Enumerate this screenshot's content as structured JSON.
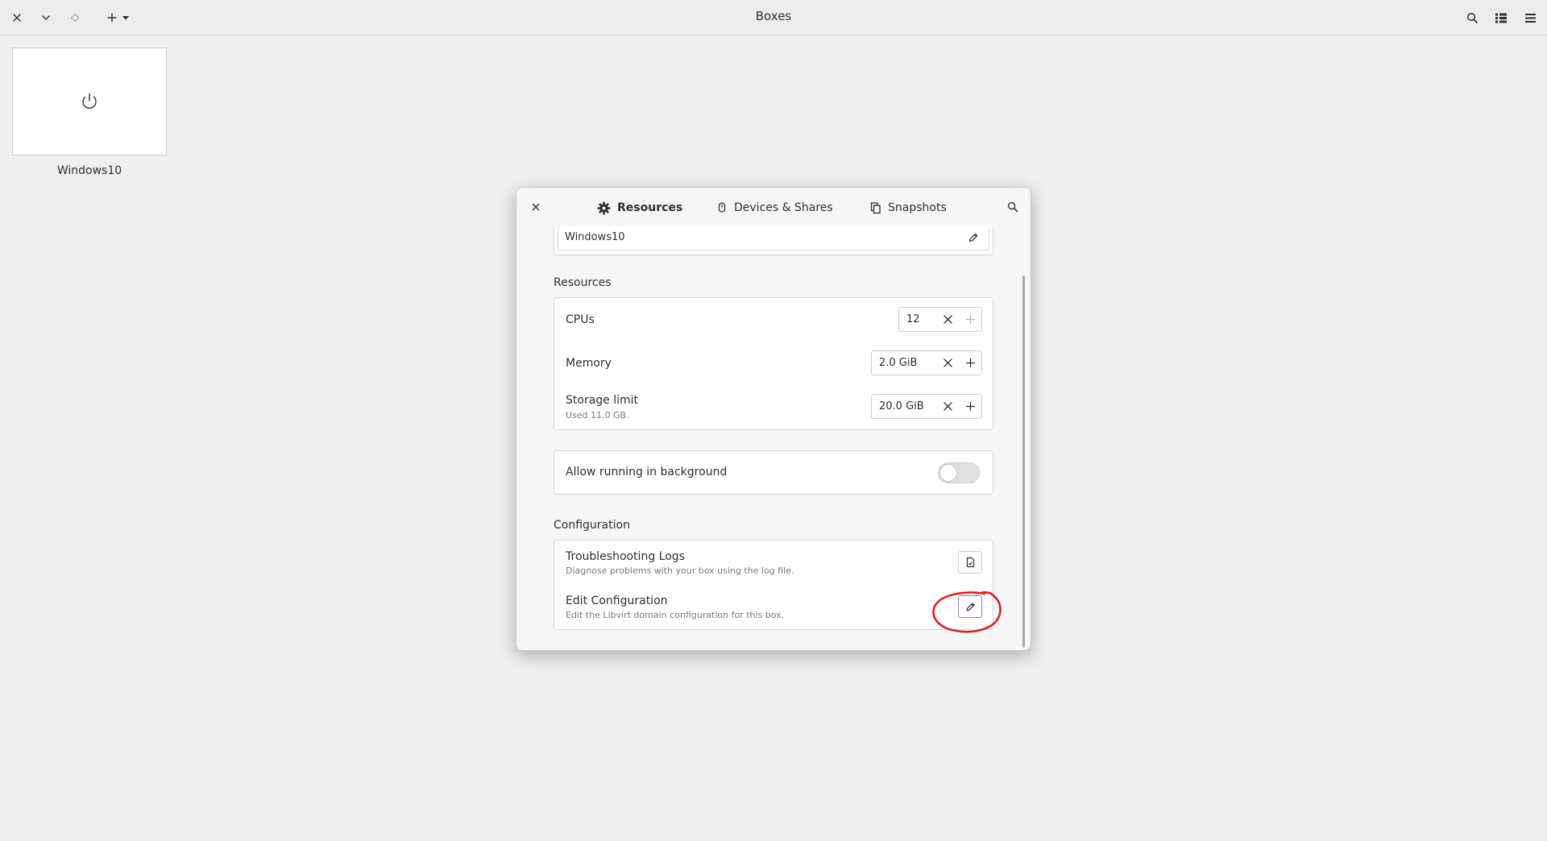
{
  "window": {
    "title": "Boxes"
  },
  "boxes": [
    {
      "name": "Windows10"
    }
  ],
  "dialog": {
    "tabs": [
      {
        "label": "Resources",
        "icon": "gear-icon",
        "active": true
      },
      {
        "label": "Devices & Shares",
        "icon": "mouse-icon",
        "active": false
      },
      {
        "label": "Snapshots",
        "icon": "snapshots-icon",
        "active": false
      }
    ],
    "name_field": {
      "value": "Windows10"
    },
    "resources": {
      "title": "Resources",
      "cpus": {
        "label": "CPUs",
        "value": "12"
      },
      "memory": {
        "label": "Memory",
        "value": "2.0 GiB"
      },
      "storage": {
        "label": "Storage limit",
        "sublabel": "Used 11.0 GB.",
        "value": "20.0 GiB"
      }
    },
    "background": {
      "label": "Allow running in background",
      "enabled": false
    },
    "configuration": {
      "title": "Configuration",
      "logs": {
        "label": "Troubleshooting Logs",
        "sublabel": "Diagnose problems with your box using the log file."
      },
      "edit": {
        "label": "Edit Configuration",
        "sublabel": "Edit the Libvirt domain configuration for this box."
      }
    }
  },
  "colors": {
    "annotation": "#e0201e",
    "focus_ring": "#a56de2"
  }
}
